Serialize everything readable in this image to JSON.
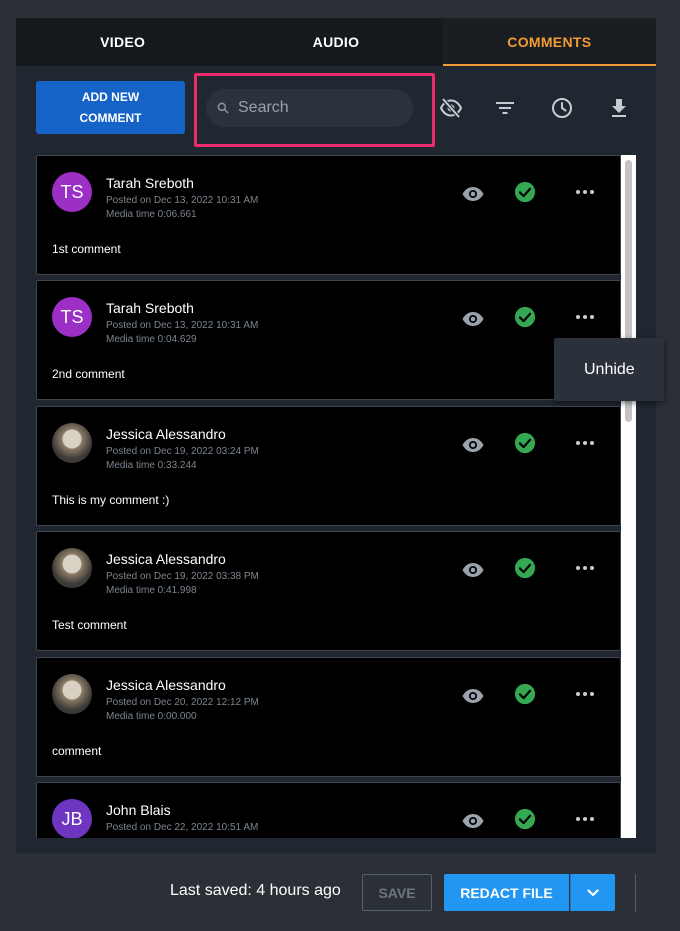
{
  "tabs": [
    {
      "label": "VIDEO",
      "active": false
    },
    {
      "label": "AUDIO",
      "active": false
    },
    {
      "label": "COMMENTS",
      "active": true
    }
  ],
  "toolbar": {
    "add_line1": "ADD NEW",
    "add_line2": "COMMENT",
    "search_placeholder": "Search",
    "icons": [
      "visibility-off-icon",
      "filter-icon",
      "clock-icon",
      "download-icon"
    ]
  },
  "comments": [
    {
      "initials": "TS",
      "name": "Tarah Sreboth",
      "posted": "Posted on Dec 13, 2022 10:31 AM",
      "media": "Media time 0:06.661",
      "text": "1st comment"
    },
    {
      "initials": "TS",
      "name": "Tarah Sreboth",
      "posted": "Posted on Dec 13, 2022 10:31 AM",
      "media": "Media time 0:04.629",
      "text": "2nd comment"
    },
    {
      "initials": "",
      "name": "Jessica Alessandro",
      "posted": "Posted on Dec 19, 2022 03:24 PM",
      "media": "Media time 0:33.244",
      "text": "This is my comment :)"
    },
    {
      "initials": "",
      "name": "Jessica Alessandro",
      "posted": "Posted on Dec 19, 2022 03:38 PM",
      "media": "Media time 0:41.998",
      "text": "Test comment"
    },
    {
      "initials": "",
      "name": "Jessica Alessandro",
      "posted": "Posted on Dec 20, 2022 12:12 PM",
      "media": "Media time 0:00.000",
      "text": "comment"
    },
    {
      "initials": "JB",
      "name": "John Blais",
      "posted": "Posted on Dec 22, 2022 10:51 AM",
      "media": "",
      "text": ""
    }
  ],
  "context_menu": {
    "item": "Unhide"
  },
  "footer": {
    "last_saved": "Last saved: 4 hours ago",
    "save_label": "SAVE",
    "redact_label": "REDACT FILE"
  },
  "colors": {
    "accent": "#f39c35",
    "primary": "#1663c7",
    "redact": "#2196f3",
    "highlight": "#ee2a6a",
    "check": "#34a853"
  }
}
